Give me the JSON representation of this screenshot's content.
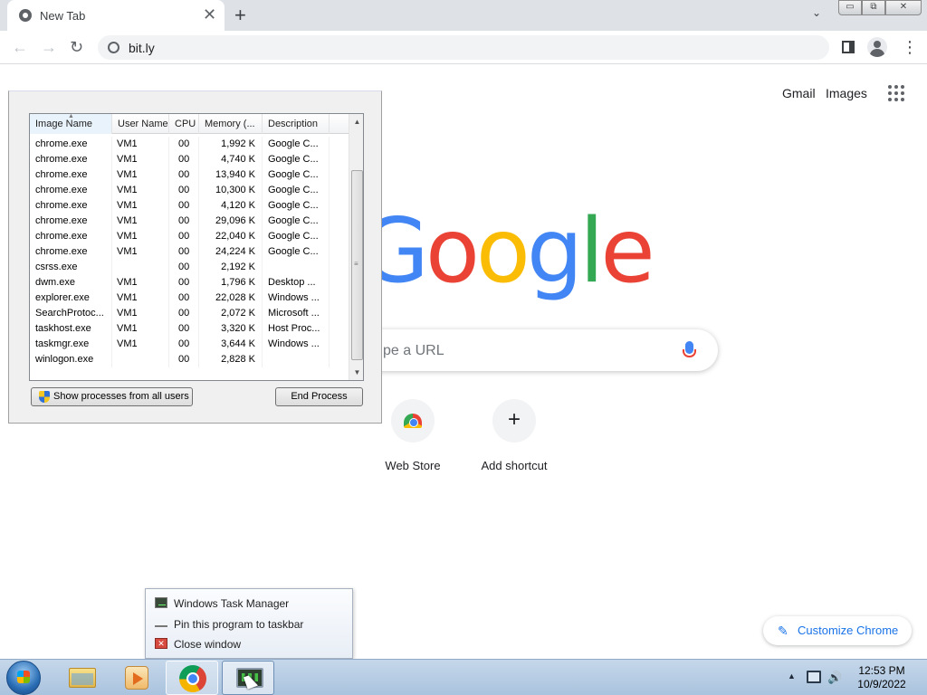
{
  "browser": {
    "tab_title": "New Tab",
    "tab_close": "✕",
    "new_tab": "+",
    "tab_search": "⌄",
    "window_buttons": {
      "minimize": "▭",
      "restore": "⧉",
      "close": "✕"
    },
    "nav": {
      "back": "←",
      "forward": "→",
      "reload": "↻"
    },
    "url": "bit.ly",
    "menu": "⋮"
  },
  "ntp": {
    "gmail": "Gmail",
    "images": "Images",
    "logo_letters": [
      "G",
      "o",
      "o",
      "g",
      "l",
      "e"
    ],
    "logo_colors": [
      "#4285f4",
      "#ea4335",
      "#fbbc05",
      "#4285f4",
      "#34a853",
      "#ea4335"
    ],
    "search_placeholder": "pe a URL",
    "shortcuts": [
      {
        "label": "Web Store",
        "icon": "web-store-icon"
      },
      {
        "label": "Add shortcut",
        "icon": "plus-icon",
        "glyph": "+"
      }
    ],
    "customize": {
      "label": "Customize Chrome",
      "icon": "pencil-icon",
      "glyph": "✎"
    }
  },
  "task_manager": {
    "columns": [
      "Image Name",
      "User Name",
      "CPU",
      "Memory (...",
      "Description"
    ],
    "sort_indicator": "▲",
    "processes": [
      [
        "chrome.exe",
        "VM1",
        "00",
        "1,992 K",
        "Google C..."
      ],
      [
        "chrome.exe",
        "VM1",
        "00",
        "4,740 K",
        "Google C..."
      ],
      [
        "chrome.exe",
        "VM1",
        "00",
        "13,940 K",
        "Google C..."
      ],
      [
        "chrome.exe",
        "VM1",
        "00",
        "10,300 K",
        "Google C..."
      ],
      [
        "chrome.exe",
        "VM1",
        "00",
        "4,120 K",
        "Google C..."
      ],
      [
        "chrome.exe",
        "VM1",
        "00",
        "29,096 K",
        "Google C..."
      ],
      [
        "chrome.exe",
        "VM1",
        "00",
        "22,040 K",
        "Google C..."
      ],
      [
        "chrome.exe",
        "VM1",
        "00",
        "24,224 K",
        "Google C..."
      ],
      [
        "csrss.exe",
        "",
        "00",
        "2,192 K",
        ""
      ],
      [
        "dwm.exe",
        "VM1",
        "00",
        "1,796 K",
        "Desktop ..."
      ],
      [
        "explorer.exe",
        "VM1",
        "00",
        "22,028 K",
        "Windows ..."
      ],
      [
        "SearchProtoc...",
        "VM1",
        "00",
        "2,072 K",
        "Microsoft ..."
      ],
      [
        "taskhost.exe",
        "VM1",
        "00",
        "3,320 K",
        "Host Proc..."
      ],
      [
        "taskmgr.exe",
        "VM1",
        "00",
        "3,644 K",
        "Windows ..."
      ],
      [
        "winlogon.exe",
        "",
        "00",
        "2,828 K",
        ""
      ]
    ],
    "scroll_up": "▲",
    "scroll_down": "▼",
    "scroll_grip": "≡",
    "show_all_button": "Show processes from all users",
    "end_process_button": "End Process"
  },
  "jump_list": {
    "items": [
      {
        "label": "Windows Task Manager",
        "icon": "task-manager-icon"
      },
      {
        "label": "Pin this program to taskbar",
        "icon": "pin-icon"
      },
      {
        "label": "Close window",
        "icon": "close-window-icon",
        "glyph": "✕"
      }
    ]
  },
  "taskbar": {
    "pinned": [
      "windows-explorer-icon",
      "media-player-icon",
      "chrome-icon",
      "task-manager-icon"
    ],
    "tray_arrow": "▲",
    "volume": "🔊",
    "time": "12:53 PM",
    "date": "10/9/2022"
  }
}
